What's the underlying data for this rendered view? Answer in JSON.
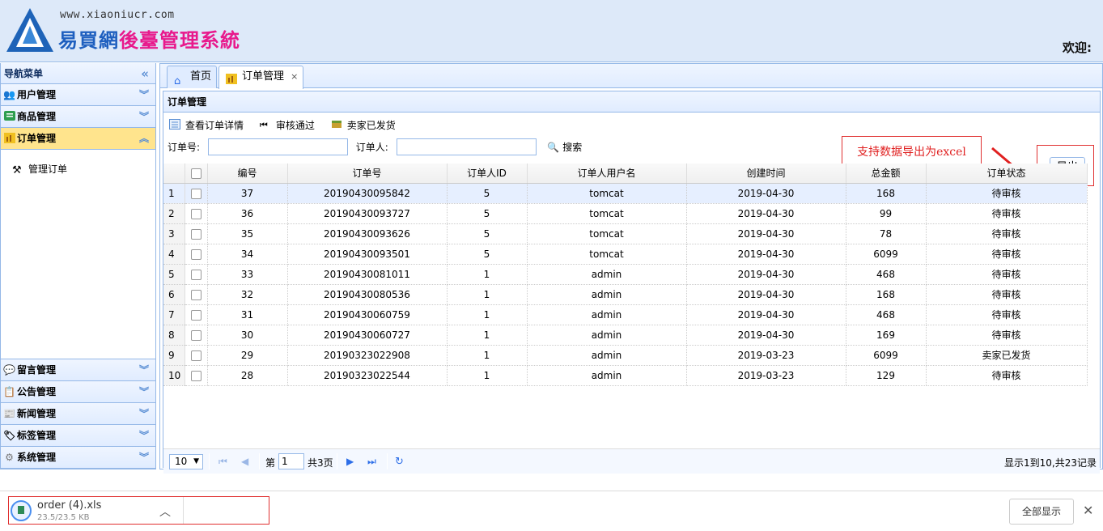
{
  "header": {
    "url_text": "www.xiaoniucr.com",
    "title_part1": "易買網",
    "title_part2": "後臺管理系統",
    "welcome": "欢迎:"
  },
  "sidebar": {
    "title": "导航菜单",
    "collapse_glyph": "«",
    "menus_top": [
      {
        "label": "用户管理",
        "icon": "users-icon"
      },
      {
        "label": "商品管理",
        "icon": "list-icon"
      },
      {
        "label": "订单管理",
        "icon": "chart-icon"
      }
    ],
    "active_submenu": [
      {
        "label": "管理订单",
        "icon": "tools-icon"
      }
    ],
    "menus_bottom": [
      {
        "label": "留言管理",
        "icon": "comment-icon"
      },
      {
        "label": "公告管理",
        "icon": "notice-icon"
      },
      {
        "label": "新闻管理",
        "icon": "news-icon"
      },
      {
        "label": "标签管理",
        "icon": "tag-icon"
      },
      {
        "label": "系统管理",
        "icon": "gear-icon"
      }
    ]
  },
  "tabs": [
    {
      "label": "首页",
      "icon": "home-icon"
    },
    {
      "label": "订单管理",
      "icon": "chart-icon",
      "close": "×"
    }
  ],
  "panel": {
    "title": "订单管理",
    "toolbar": [
      {
        "label": "查看订单详情",
        "icon": "detail-icon"
      },
      {
        "label": "审核通过",
        "icon": "approve-icon"
      },
      {
        "label": "卖家已发货",
        "icon": "ship-icon"
      }
    ],
    "search": {
      "order_no_label": "订单号:",
      "orderer_label": "订单人:",
      "search_label": "搜索"
    },
    "annotation": "支持数据导出为excel",
    "export_label": "导出"
  },
  "grid": {
    "columns": [
      "编号",
      "订单号",
      "订单人ID",
      "订单人用户名",
      "创建时间",
      "总金额",
      "订单状态"
    ],
    "rows": [
      [
        "1",
        "37",
        "20190430095842",
        "5",
        "tomcat",
        "2019-04-30",
        "168",
        "待审核"
      ],
      [
        "2",
        "36",
        "20190430093727",
        "5",
        "tomcat",
        "2019-04-30",
        "99",
        "待审核"
      ],
      [
        "3",
        "35",
        "20190430093626",
        "5",
        "tomcat",
        "2019-04-30",
        "78",
        "待审核"
      ],
      [
        "4",
        "34",
        "20190430093501",
        "5",
        "tomcat",
        "2019-04-30",
        "6099",
        "待审核"
      ],
      [
        "5",
        "33",
        "20190430081011",
        "1",
        "admin",
        "2019-04-30",
        "468",
        "待审核"
      ],
      [
        "6",
        "32",
        "20190430080536",
        "1",
        "admin",
        "2019-04-30",
        "168",
        "待审核"
      ],
      [
        "7",
        "31",
        "20190430060759",
        "1",
        "admin",
        "2019-04-30",
        "468",
        "待审核"
      ],
      [
        "8",
        "30",
        "20190430060727",
        "1",
        "admin",
        "2019-04-30",
        "169",
        "待审核"
      ],
      [
        "9",
        "29",
        "20190323022908",
        "1",
        "admin",
        "2019-03-23",
        "6099",
        "卖家已发货"
      ],
      [
        "10",
        "28",
        "20190323022544",
        "1",
        "admin",
        "2019-03-23",
        "129",
        "待审核"
      ]
    ]
  },
  "pager": {
    "page_size": "10",
    "page_prefix": "第",
    "page_value": "1",
    "page_suffix": "共3页",
    "info": "显示1到10,共23记录"
  },
  "download": {
    "filename": "order (4).xls",
    "size": "23.5/23.5 KB",
    "show_all": "全部显示",
    "close": "✕"
  },
  "colors": {
    "header_bg": "#dde9f9",
    "border": "#95b8e7",
    "active_menu": "#ffe48d",
    "annotation_red": "#e02020"
  }
}
